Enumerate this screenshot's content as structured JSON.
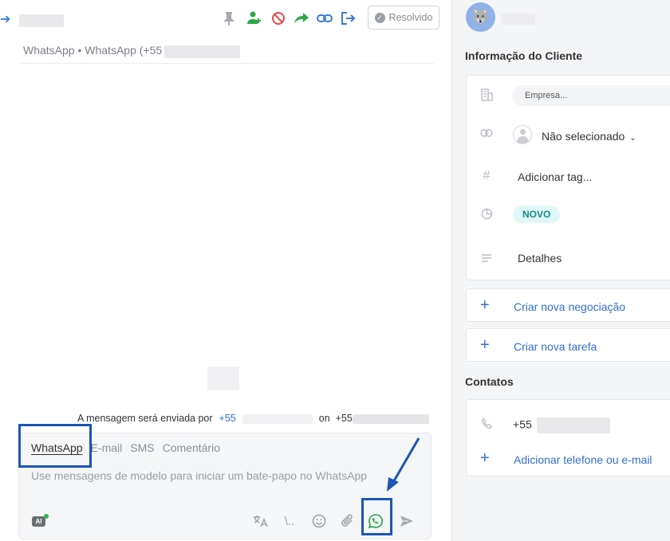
{
  "toolbar": {
    "resolve_label": "Resolvido",
    "icons": [
      "pin-icon",
      "assign-user-icon",
      "block-icon",
      "forward-icon",
      "link-icon",
      "exit-icon"
    ]
  },
  "conversation": {
    "channel_text": "WhatsApp • WhatsApp (+55"
  },
  "send_info": {
    "prefix": "A mensagem será enviada por",
    "from_phone": "+55",
    "on": "on",
    "to_phone": "+55"
  },
  "composer": {
    "tabs": [
      "WhatsApp",
      "E-mail",
      "SMS",
      "Comentário"
    ],
    "active_tab": "WhatsApp",
    "placeholder": "Use mensagens de modelo para iniciar um bate-papo no WhatsApp",
    "ai_label": "AI"
  },
  "customer_info": {
    "title": "Informação do Cliente",
    "company_placeholder": "Empresa...",
    "assignee": "Não selecionado",
    "tag_placeholder": "Adicionar tag...",
    "stage": "NOVO",
    "details": "Detalhes"
  },
  "actions": {
    "new_deal": "Criar nova negociação",
    "new_task": "Criar nova tarefa"
  },
  "contacts": {
    "title": "Contatos",
    "phone": "+55",
    "add_label": "Adicionar telefone ou e-mail"
  },
  "colors": {
    "accent": "#2f6fd1",
    "whatsapp_green": "#25a244",
    "highlight": "#1c56b4",
    "stage_badge_bg": "#e0f7f6",
    "stage_badge_text": "#158a8a"
  }
}
